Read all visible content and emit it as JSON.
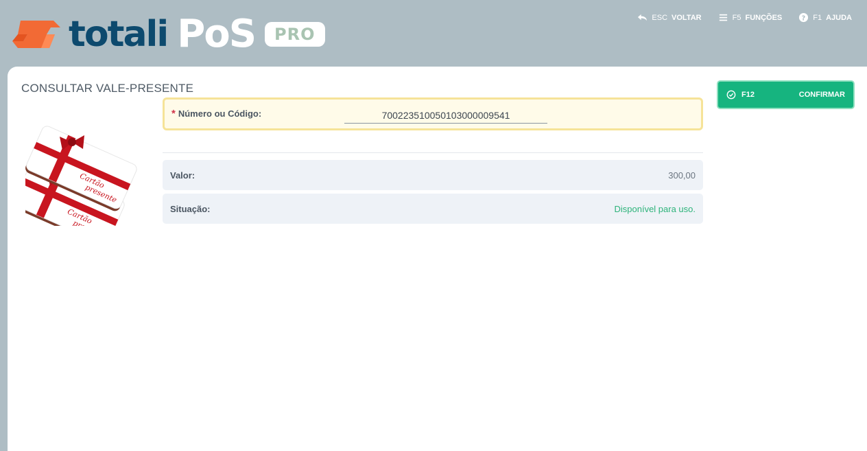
{
  "brand": {
    "name": "totali",
    "product": "PoS",
    "edition": "PRO",
    "colors": {
      "primary": "#0d4a6e",
      "accent": "#f26a35",
      "header_bg": "#aebdc4",
      "success": "#16b47f"
    }
  },
  "top_actions": [
    {
      "key": "ESC",
      "label": "VOLTAR",
      "icon": "undo-arrow-icon"
    },
    {
      "key": "F5",
      "label": "FUNÇÕES",
      "icon": "menu-lines-icon"
    },
    {
      "key": "F1",
      "label": "AJUDA",
      "icon": "help-circle-icon"
    }
  ],
  "page": {
    "title": "CONSULTAR VALE-PRESENTE",
    "illustration_text": [
      "Cartão",
      "presente"
    ]
  },
  "form": {
    "code_label": "Número ou Código:",
    "required_mark": "*",
    "code_value": "70022351005010300000954​1"
  },
  "details": {
    "valor_label": "Valor:",
    "valor_value": "300,00",
    "situacao_label": "Situação:",
    "situacao_value": "Disponível para uso."
  },
  "confirm": {
    "key": "F12",
    "label": "CONFIRMAR",
    "icon": "check-circle-icon"
  }
}
